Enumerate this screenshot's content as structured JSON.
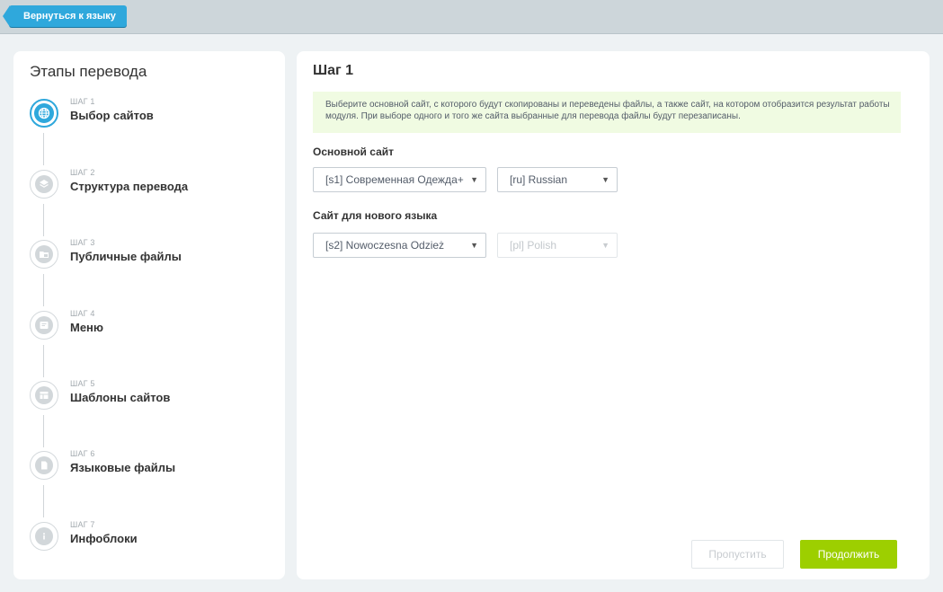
{
  "topbar": {
    "back_label": "Вернуться к языку"
  },
  "sidebar": {
    "title": "Этапы перевода",
    "steps": [
      {
        "label": "ШАГ 1",
        "name": "Выбор сайтов",
        "icon": "globe-icon",
        "active": true
      },
      {
        "label": "ШАГ 2",
        "name": "Структура перевода",
        "icon": "layers-icon",
        "active": false
      },
      {
        "label": "ШАГ 3",
        "name": "Публичные файлы",
        "icon": "folder-icon",
        "active": false
      },
      {
        "label": "ШАГ 4",
        "name": "Меню",
        "icon": "menu-icon",
        "active": false
      },
      {
        "label": "ШАГ 5",
        "name": "Шаблоны сайтов",
        "icon": "template-icon",
        "active": false
      },
      {
        "label": "ШАГ 6",
        "name": "Языковые файлы",
        "icon": "file-icon",
        "active": false
      },
      {
        "label": "ШАГ 7",
        "name": "Инфоблоки",
        "icon": "info-icon",
        "active": false
      }
    ]
  },
  "main": {
    "title": "Шаг 1",
    "info": "Выберите основной сайт, с которого будут скопированы и переведены файлы, а также сайт, на котором отобразится результат работы модуля. При выборе одного и того же сайта выбранные для перевода файлы будут перезаписаны.",
    "source": {
      "label": "Основной сайт",
      "site_value": "[s1] Современная Одежда+",
      "lang_value": "[ru] Russian"
    },
    "target": {
      "label": "Сайт для нового языка",
      "site_value": "[s2] Nowoczesna Odzież",
      "lang_value": "[pl] Polish"
    },
    "skip_label": "Пропустить",
    "continue_label": "Продолжить"
  },
  "colors": {
    "accent": "#2fa8dc",
    "continue_button": "#9dcf00",
    "info_background": "#f0fbe2"
  }
}
